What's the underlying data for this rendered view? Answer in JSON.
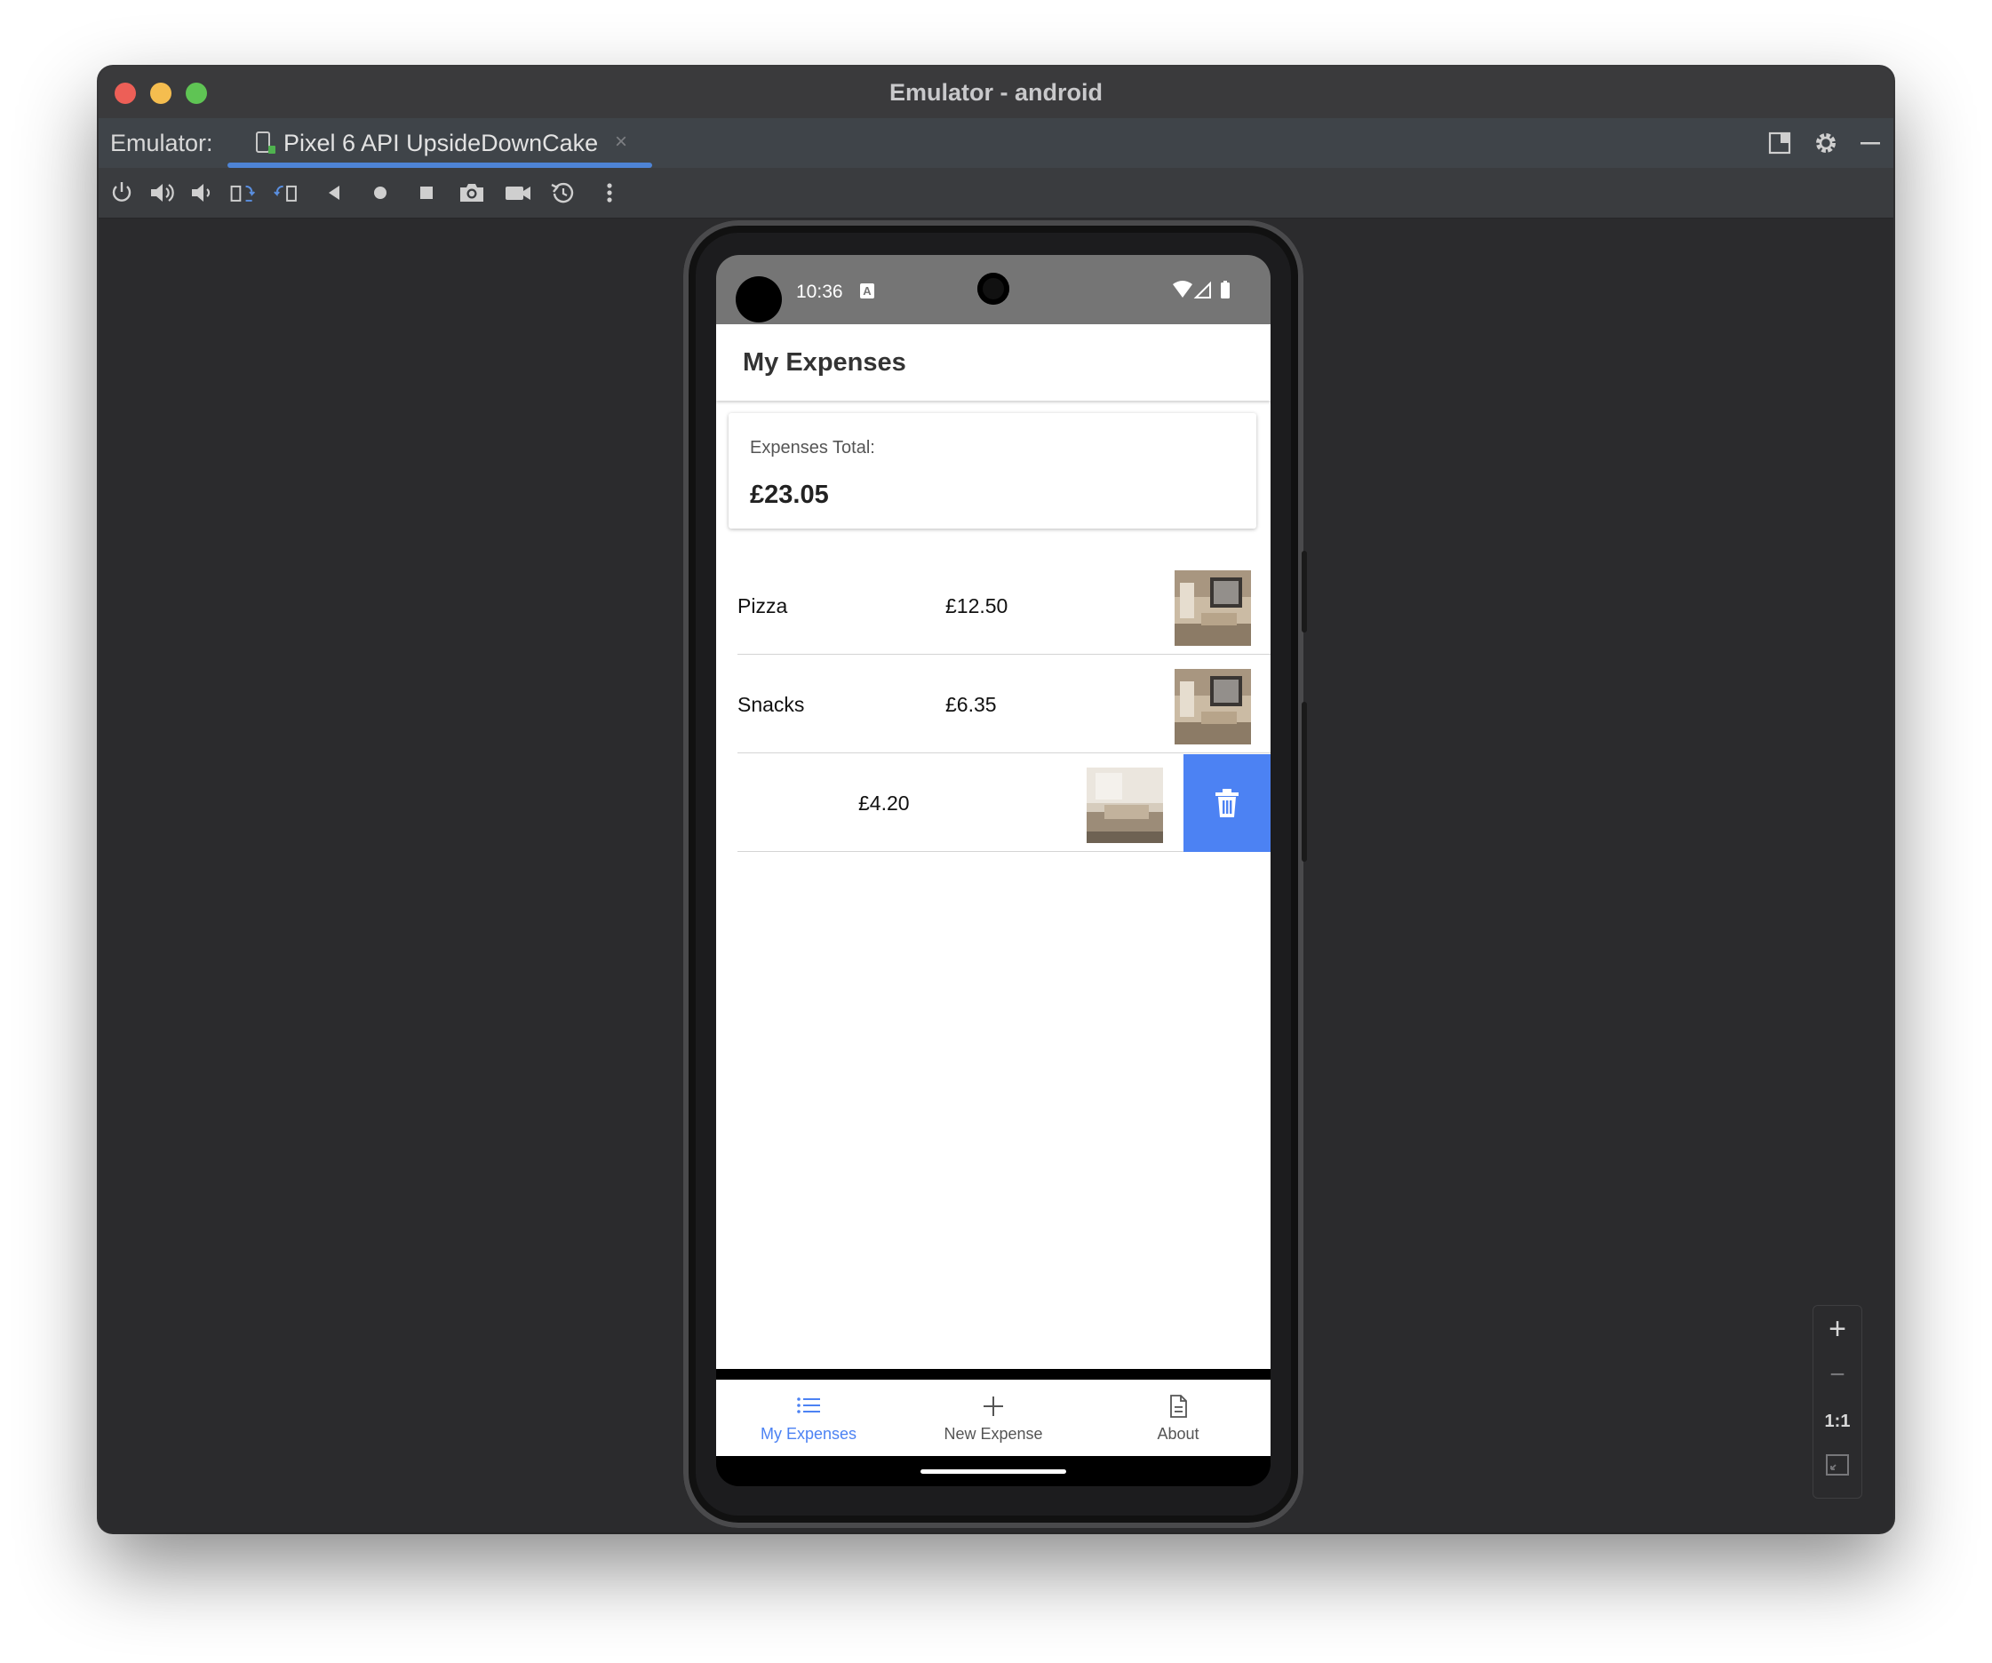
{
  "window": {
    "title": "Emulator - android",
    "traffic_lights": {
      "close": "#ed5f57",
      "minimize": "#f5bd4f",
      "zoom": "#5fc454"
    }
  },
  "tabbar": {
    "prefix": "Emulator:",
    "device_tab": {
      "label": "Pixel 6 API UpsideDownCake",
      "icon": "device-phone-icon",
      "close": "×"
    },
    "right_icons": [
      "layout-icon",
      "gear-icon",
      "minimize-icon"
    ]
  },
  "toolbar": {
    "buttons": [
      {
        "name": "power-button",
        "icon": "power-icon"
      },
      {
        "name": "volume-up-button",
        "icon": "volume-up-icon"
      },
      {
        "name": "volume-down-button",
        "icon": "volume-down-icon"
      },
      {
        "name": "rotate-left-button",
        "icon": "rotate-left-icon"
      },
      {
        "name": "rotate-right-button",
        "icon": "rotate-right-icon"
      },
      {
        "name": "back-button",
        "icon": "back-triangle-icon"
      },
      {
        "name": "home-button",
        "icon": "home-circle-icon"
      },
      {
        "name": "overview-button",
        "icon": "overview-square-icon"
      },
      {
        "name": "screenshot-button",
        "icon": "camera-icon"
      },
      {
        "name": "screen-record-button",
        "icon": "video-camera-icon"
      },
      {
        "name": "snapshot-button",
        "icon": "snapshot-restore-icon"
      },
      {
        "name": "more-button",
        "icon": "more-vertical-icon"
      }
    ]
  },
  "phone": {
    "status_bar": {
      "time": "10:36",
      "badge": "A",
      "icons": [
        "wifi-icon",
        "cell-signal-icon",
        "battery-icon"
      ]
    },
    "app_bar": {
      "title": "My Expenses"
    },
    "total_card": {
      "label": "Expenses Total:",
      "value": "£23.05"
    },
    "expenses": [
      {
        "name": "Pizza",
        "amount": "£12.50",
        "thumbnail": "room-photo-icon"
      },
      {
        "name": "Snacks",
        "amount": "£6.35",
        "thumbnail": "room-photo-icon"
      },
      {
        "name": "",
        "amount": "£4.20",
        "thumbnail": "room-photo-icon",
        "swiped": true
      }
    ],
    "delete_action": {
      "icon": "trash-icon",
      "color": "#4c82f3"
    },
    "bottom_nav": [
      {
        "label": "My Expenses",
        "icon": "list-icon",
        "active": true
      },
      {
        "label": "New Expense",
        "icon": "plus-icon",
        "active": false
      },
      {
        "label": "About",
        "icon": "document-icon",
        "active": false
      }
    ],
    "accent_color": "#4c82f3"
  },
  "zoom_controls": {
    "zoom_in": "+",
    "zoom_out": "−",
    "actual_size": "1:1",
    "fit_icon": "fit-screen-icon"
  }
}
